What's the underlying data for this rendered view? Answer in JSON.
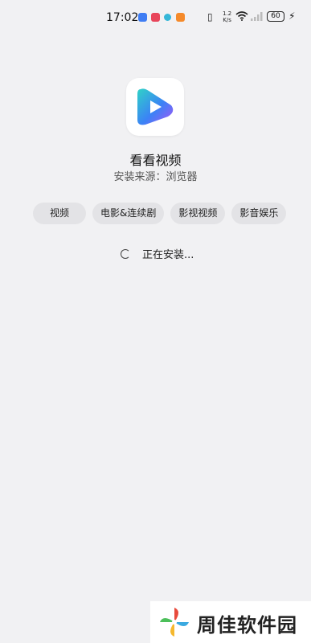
{
  "status_bar": {
    "time": "17:02",
    "net_speed_value": "1.2",
    "net_speed_unit": "K/s",
    "battery": "60",
    "vibrate_glyph": "▯",
    "bolt_glyph": "⚡"
  },
  "app": {
    "icon": "play-icon",
    "name": "看看视频",
    "source": "安装来源：浏览器",
    "colors": {
      "gradient_start": "#2fd3c7",
      "gradient_end": "#a855f7"
    }
  },
  "tags": [
    "视频",
    "电影&连续剧",
    "影视视频",
    "影音娱乐"
  ],
  "status": {
    "installing_text": "正在安装..."
  },
  "watermark": {
    "text": "周佳软件园"
  }
}
